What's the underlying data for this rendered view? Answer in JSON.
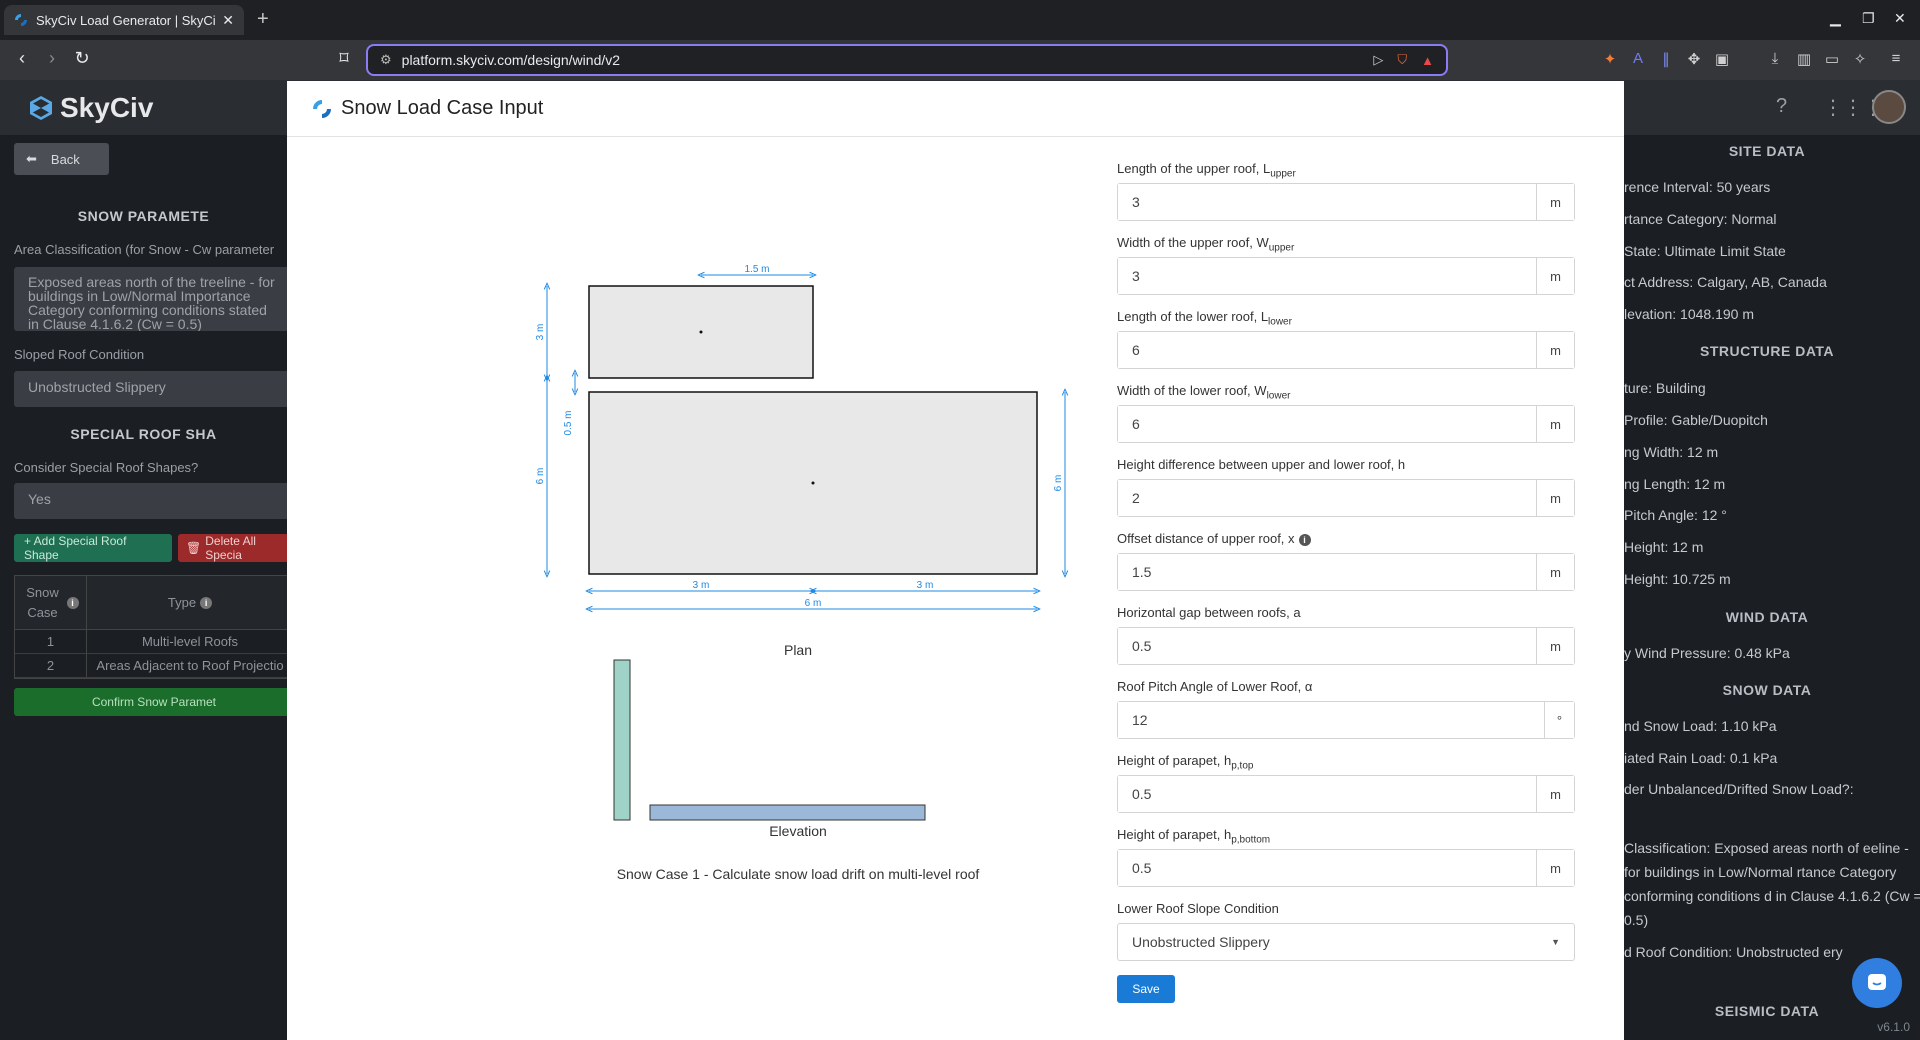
{
  "browser": {
    "tab_title": "SkyCiv Load Generator | SkyCi",
    "url": "platform.skyciv.com/design/wind/v2"
  },
  "app": {
    "logo_text": "SkyCiv",
    "version": "v6.1.0"
  },
  "left_panel": {
    "back_label": "Back",
    "snow_params_heading": "SNOW PARAMETE",
    "area_class_label": "Area Classification (for Snow - Cw parameter",
    "area_class_value": "Exposed areas north of the treeline - for buildings in Low/Normal Importance Category conforming conditions stated in Clause 4.1.6.2 (Cw = 0.5)",
    "sloped_roof_label": "Sloped Roof Condition",
    "sloped_roof_value": "Unobstructed Slippery",
    "special_heading": "SPECIAL ROOF SHA",
    "consider_label": "Consider Special Roof Shapes?",
    "consider_value": "Yes",
    "add_btn": "+ Add Special Roof Shape",
    "delete_btn": "Delete All Specia",
    "table_headers": [
      "Snow Case",
      "Type"
    ],
    "table_rows": [
      {
        "case": "1",
        "type": "Multi-level Roofs"
      },
      {
        "case": "2",
        "type": "Areas Adjacent to Roof Projectio"
      }
    ],
    "confirm_btn": "Confirm Snow Paramet"
  },
  "right_panel": {
    "site_heading": "SITE DATA",
    "site_lines": [
      "rence Interval: 50 years",
      "rtance Category: Normal",
      "State: Ultimate Limit State",
      "ct Address: Calgary, AB, Canada",
      "levation: 1048.190 m"
    ],
    "structure_heading": "STRUCTURE DATA",
    "structure_lines": [
      "ture: Building",
      "Profile: Gable/Duopitch",
      "ng Width: 12 m",
      "ng Length: 12 m",
      "Pitch Angle: 12 °",
      "Height: 12 m",
      "Height: 10.725 m"
    ],
    "wind_heading": "WIND DATA",
    "wind_lines": [
      "y Wind Pressure: 0.48 kPa"
    ],
    "snow_heading": "SNOW DATA",
    "snow_lines": [
      "nd Snow Load: 1.10 kPa",
      "iated Rain Load: 0.1 kPa",
      "der Unbalanced/Drifted Snow Load?:"
    ],
    "snow_para1": "Classification: Exposed areas north of eeline - for buildings in Low/Normal rtance Category conforming conditions d in Clause 4.1.6.2 (Cw = 0.5)",
    "snow_para2": "d Roof Condition: Unobstructed ery",
    "seismic_heading": "SEISMIC DATA"
  },
  "modal": {
    "title": "Snow Load Case Input",
    "drawing": {
      "dim_top": "1.5 m",
      "dim_upper_h": "3 m",
      "dim_gap": "0.5 m",
      "dim_lower_h_left": "6 m",
      "dim_lower_h_right": "6 m",
      "dim_bottom_a": "3 m",
      "dim_bottom_b": "3 m",
      "dim_bottom_total": "6 m",
      "plan_label": "Plan",
      "elevation_label": "Elevation",
      "caption": "Snow Case 1 - Calculate snow load drift on multi-level roof"
    },
    "fields": [
      {
        "label": "Length of the upper roof, L",
        "sub": "upper",
        "value": "3",
        "unit": "m"
      },
      {
        "label": "Width of the upper roof, W",
        "sub": "upper",
        "value": "3",
        "unit": "m"
      },
      {
        "label": "Length of the lower roof, L",
        "sub": "lower",
        "value": "6",
        "unit": "m"
      },
      {
        "label": "Width of the lower roof, W",
        "sub": "lower",
        "value": "6",
        "unit": "m"
      },
      {
        "label": "Height difference between upper and lower roof, h",
        "sub": "",
        "value": "2",
        "unit": "m"
      },
      {
        "label": "Offset distance of upper roof, x",
        "sub": "",
        "value": "1.5",
        "unit": "m"
      },
      {
        "label": "Horizontal gap between roofs, a",
        "sub": "",
        "value": "0.5",
        "unit": "m"
      },
      {
        "label": "Roof Pitch Angle of Lower Roof, α",
        "sub": "",
        "value": "12",
        "unit": "°"
      },
      {
        "label": "Height of parapet, h",
        "sub": "p,top",
        "value": "0.5",
        "unit": "m"
      },
      {
        "label": "Height of parapet, h",
        "sub": "p,bottom",
        "value": "0.5",
        "unit": "m"
      }
    ],
    "slope_label": "Lower Roof Slope Condition",
    "slope_value": "Unobstructed Slippery",
    "save_label": "Save"
  },
  "colors": {
    "accent": "#1a7bd6",
    "elev_upper": "#9fd3c7",
    "elev_lower": "#9cb8d9",
    "dim_line": "#1e88e5"
  }
}
